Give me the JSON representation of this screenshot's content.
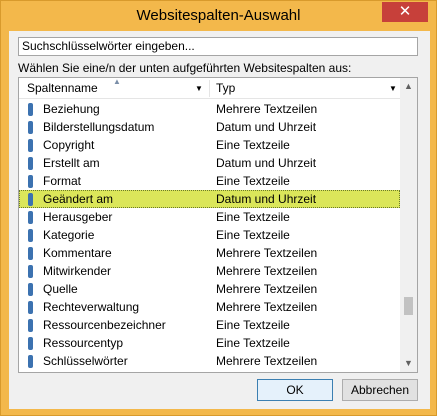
{
  "window": {
    "title": "Websitespalten-Auswahl",
    "close_glyph": "✕"
  },
  "search": {
    "placeholder": "Suchschlüsselwörter eingeben..."
  },
  "prompt": "Wählen Sie eine/n der unten aufgeführten Websitespalten aus:",
  "list": {
    "columns": [
      {
        "label": "Spaltenname"
      },
      {
        "label": "Typ"
      }
    ],
    "rows": [
      {
        "name": "Beziehung",
        "type": "Mehrere Textzeilen"
      },
      {
        "name": "Bilderstellungsdatum",
        "type": "Datum und Uhrzeit"
      },
      {
        "name": "Copyright",
        "type": "Eine Textzeile"
      },
      {
        "name": "Erstellt am",
        "type": "Datum und Uhrzeit"
      },
      {
        "name": "Format",
        "type": "Eine Textzeile"
      },
      {
        "name": "Geändert am",
        "type": "Datum und Uhrzeit"
      },
      {
        "name": "Herausgeber",
        "type": "Eine Textzeile"
      },
      {
        "name": "Kategorie",
        "type": "Eine Textzeile"
      },
      {
        "name": "Kommentare",
        "type": "Mehrere Textzeilen"
      },
      {
        "name": "Mitwirkender",
        "type": "Mehrere Textzeilen"
      },
      {
        "name": "Quelle",
        "type": "Mehrere Textzeilen"
      },
      {
        "name": "Rechteverwaltung",
        "type": "Mehrere Textzeilen"
      },
      {
        "name": "Ressourcenbezeichner",
        "type": "Eine Textzeile"
      },
      {
        "name": "Ressourcentyp",
        "type": "Eine Textzeile"
      },
      {
        "name": "Schlüsselwörter",
        "type": "Mehrere Textzeilen"
      }
    ],
    "selected_name": "Geändert am"
  },
  "buttons": {
    "ok": "OK",
    "cancel": "Abbrechen"
  },
  "colors": {
    "title_bar": "#f3b84b",
    "selection": "#dbe65a",
    "close": "#c7403a",
    "column_icon": "#3c72b0"
  }
}
